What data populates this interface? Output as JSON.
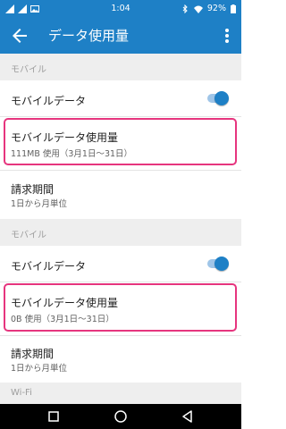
{
  "status_bar": {
    "time": "1:04",
    "battery": "92%",
    "left_icons": [
      "signal-icon",
      "signal-icon",
      "image-icon"
    ],
    "right_icons": [
      "bluetooth-icon",
      "wifi-icon",
      "battery-icon"
    ]
  },
  "app_bar": {
    "title": "データ使用量",
    "back_icon": "back-arrow-icon",
    "menu_icon": "overflow-menu-icon"
  },
  "sections": [
    {
      "header": "モバイル",
      "mobile_data_label": "モバイルデータ",
      "mobile_data_enabled": true,
      "usage_title": "モバイルデータ使用量",
      "usage_sub": "111MB 使用（3月1日〜31日）",
      "billing_title": "請求期間",
      "billing_sub": "1日から月単位"
    },
    {
      "header": "モバイル",
      "mobile_data_label": "モバイルデータ",
      "mobile_data_enabled": true,
      "usage_title": "モバイルデータ使用量",
      "usage_sub": "0B 使用（3月1日〜31日）",
      "billing_title": "請求期間",
      "billing_sub": "1日から月単位"
    }
  ],
  "wifi_header": "Wi-Fi",
  "colors": {
    "accent": "#1e80c6",
    "highlight": "#e6357e"
  },
  "nav_bar": [
    "square-recents-icon",
    "circle-home-icon",
    "triangle-back-icon"
  ]
}
